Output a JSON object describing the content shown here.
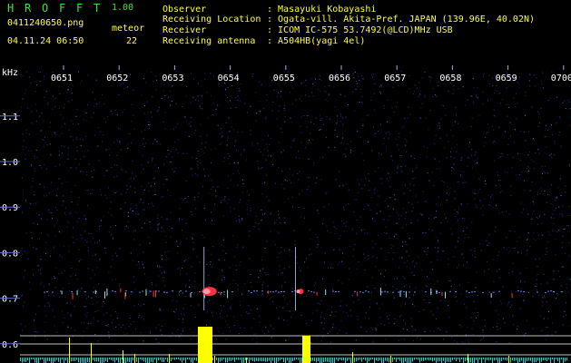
{
  "app": {
    "letters": [
      "H",
      "R",
      "O",
      "F",
      "F",
      "T"
    ],
    "version": "1.00",
    "filename": "0411240650.png",
    "timestamp": "04.11.24 06:50",
    "meteor_label": "meteor",
    "meteor_count": "22"
  },
  "info": {
    "observer_label": "Observer",
    "observer_value": ": Masayuki Kobayashi",
    "location_label": "Receiving Location",
    "location_value": ": Ogata-vill. Akita-Pref. JAPAN (139.96E, 40.02N)",
    "receiver_label": "Receiver",
    "receiver_value": ": ICOM IC-575 53.7492(@LCD)MHz USB",
    "antenna_label": "Receiving antenna",
    "antenna_value": ": A504HB(yagi 4el)"
  },
  "colors": {
    "background": "#000000",
    "title": "#3fe03f",
    "text": "#ffff33",
    "info": "#ffffff",
    "noise": "#2a3da8",
    "echo": "#ff3040",
    "meteor_bar": "#ffff00",
    "baseline_noise": "#30c8c8"
  },
  "chart_data": {
    "type": "heatmap",
    "ylabel": "kHz",
    "x_ticks": [
      "0651",
      "0652",
      "0653",
      "0654",
      "0655",
      "0656",
      "0657",
      "0658",
      "0659",
      "0700"
    ],
    "y_ticks": [
      "1.1",
      "1.0",
      "0.9",
      "0.8",
      "0.7",
      "0.6"
    ],
    "x_range_minutes": [
      0,
      10
    ],
    "y_range_khz": [
      0.58,
      1.2
    ],
    "carrier_khz": 0.715,
    "strong_echoes_minute": [
      3.35,
      5.0
    ],
    "grid": false
  }
}
